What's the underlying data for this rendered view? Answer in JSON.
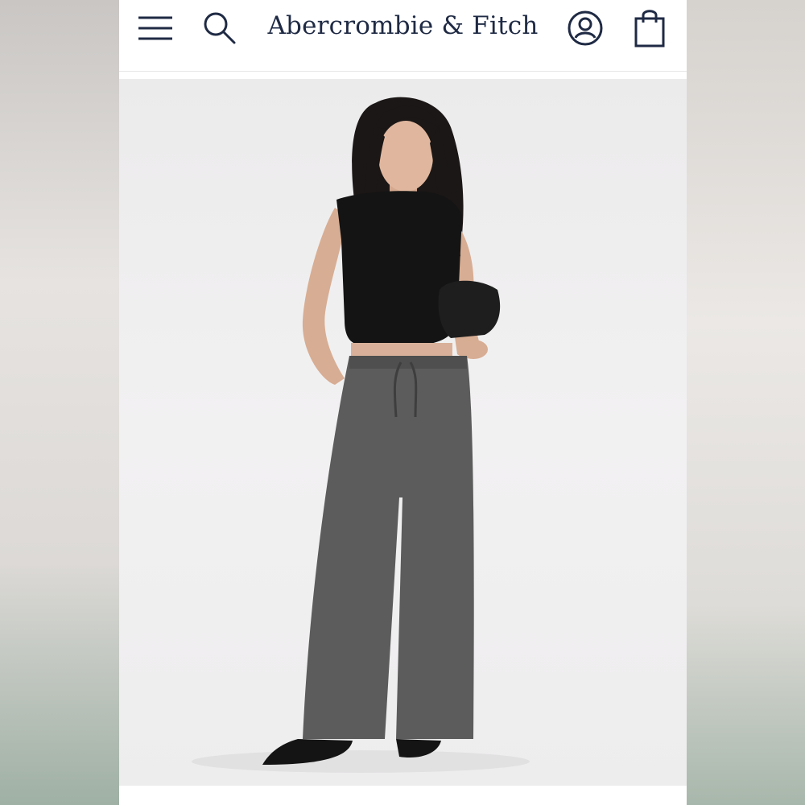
{
  "header": {
    "brand": "Abercrombie & Fitch",
    "icons": [
      "menu-icon",
      "search-icon",
      "account-icon",
      "shopping-bag-icon"
    ]
  },
  "colors": {
    "brand_navy": "#1f2a44",
    "header_bg": "#ffffff",
    "hero_bg": "#eeedee",
    "top": "#141414",
    "pants": "#5a5a5a"
  }
}
